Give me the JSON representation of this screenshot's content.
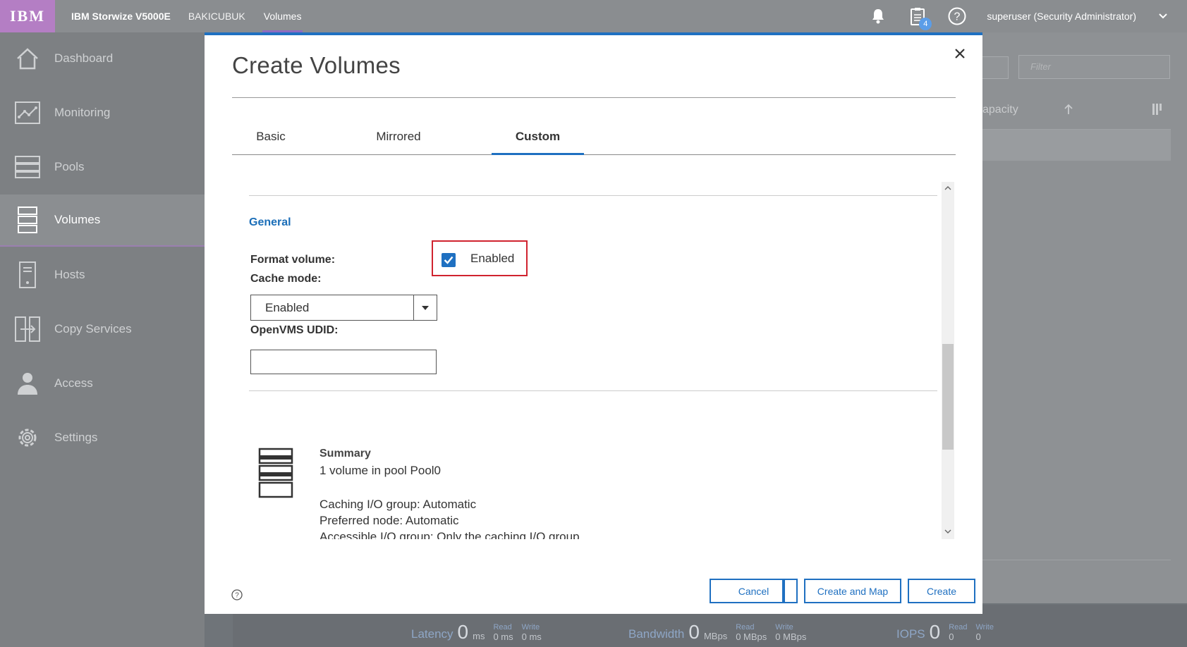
{
  "topbar": {
    "logo": "IBM",
    "product": "IBM Storwize V5000E",
    "system": "BAKICUBUK",
    "page": "Volumes",
    "tasks_badge": "4",
    "user": "superuser (Security Administrator)"
  },
  "sidebar": {
    "items": [
      {
        "label": "Dashboard",
        "icon": "home-icon"
      },
      {
        "label": "Monitoring",
        "icon": "monitoring-icon"
      },
      {
        "label": "Pools",
        "icon": "pools-icon"
      },
      {
        "label": "Volumes",
        "icon": "volumes-icon",
        "active": true
      },
      {
        "label": "Hosts",
        "icon": "hosts-icon"
      },
      {
        "label": "Copy Services",
        "icon": "copy-services-icon"
      },
      {
        "label": "Access",
        "icon": "access-icon"
      },
      {
        "label": "Settings",
        "icon": "settings-icon"
      }
    ]
  },
  "background": {
    "filter_placeholder": "Filter",
    "capacity_header": "apacity"
  },
  "modal": {
    "title": "Create Volumes",
    "tabs": [
      "Basic",
      "Mirrored",
      "Custom"
    ],
    "active_tab": "Custom",
    "section_title": "General",
    "format_label": "Format volume:",
    "format_value": "Enabled",
    "format_checked": true,
    "cache_label": "Cache mode:",
    "cache_value": "Enabled",
    "openvms_label": "OpenVMS UDID:",
    "openvms_value": "",
    "summary": {
      "title": "Summary",
      "line1": "1 volume in pool Pool0",
      "line2": "Caching I/O group: Automatic",
      "line3": "Preferred node: Automatic",
      "line4": "Accessible I/O group: Only the caching I/O group"
    },
    "buttons": {
      "cancel": "Cancel",
      "create_and_map": "Create and Map",
      "create": "Create"
    }
  },
  "statusbar": {
    "latency_label": "Latency",
    "latency_value": "0",
    "latency_unit": "ms",
    "latency_read_label": "Read",
    "latency_read": "0 ms",
    "latency_write_label": "Write",
    "latency_write": "0 ms",
    "bandwidth_label": "Bandwidth",
    "bandwidth_value": "0",
    "bandwidth_unit": "MBps",
    "bandwidth_read_label": "Read",
    "bandwidth_read": "0 MBps",
    "bandwidth_write_label": "Write",
    "bandwidth_write": "0 MBps",
    "iops_label": "IOPS",
    "iops_value": "0",
    "iops_read_label": "Read",
    "iops_read": "0",
    "iops_write_label": "Write",
    "iops_write": "0"
  },
  "colors": {
    "accent": "#1f70c1",
    "highlight": "#d0232f",
    "logo_bg": "#b47ec4"
  }
}
